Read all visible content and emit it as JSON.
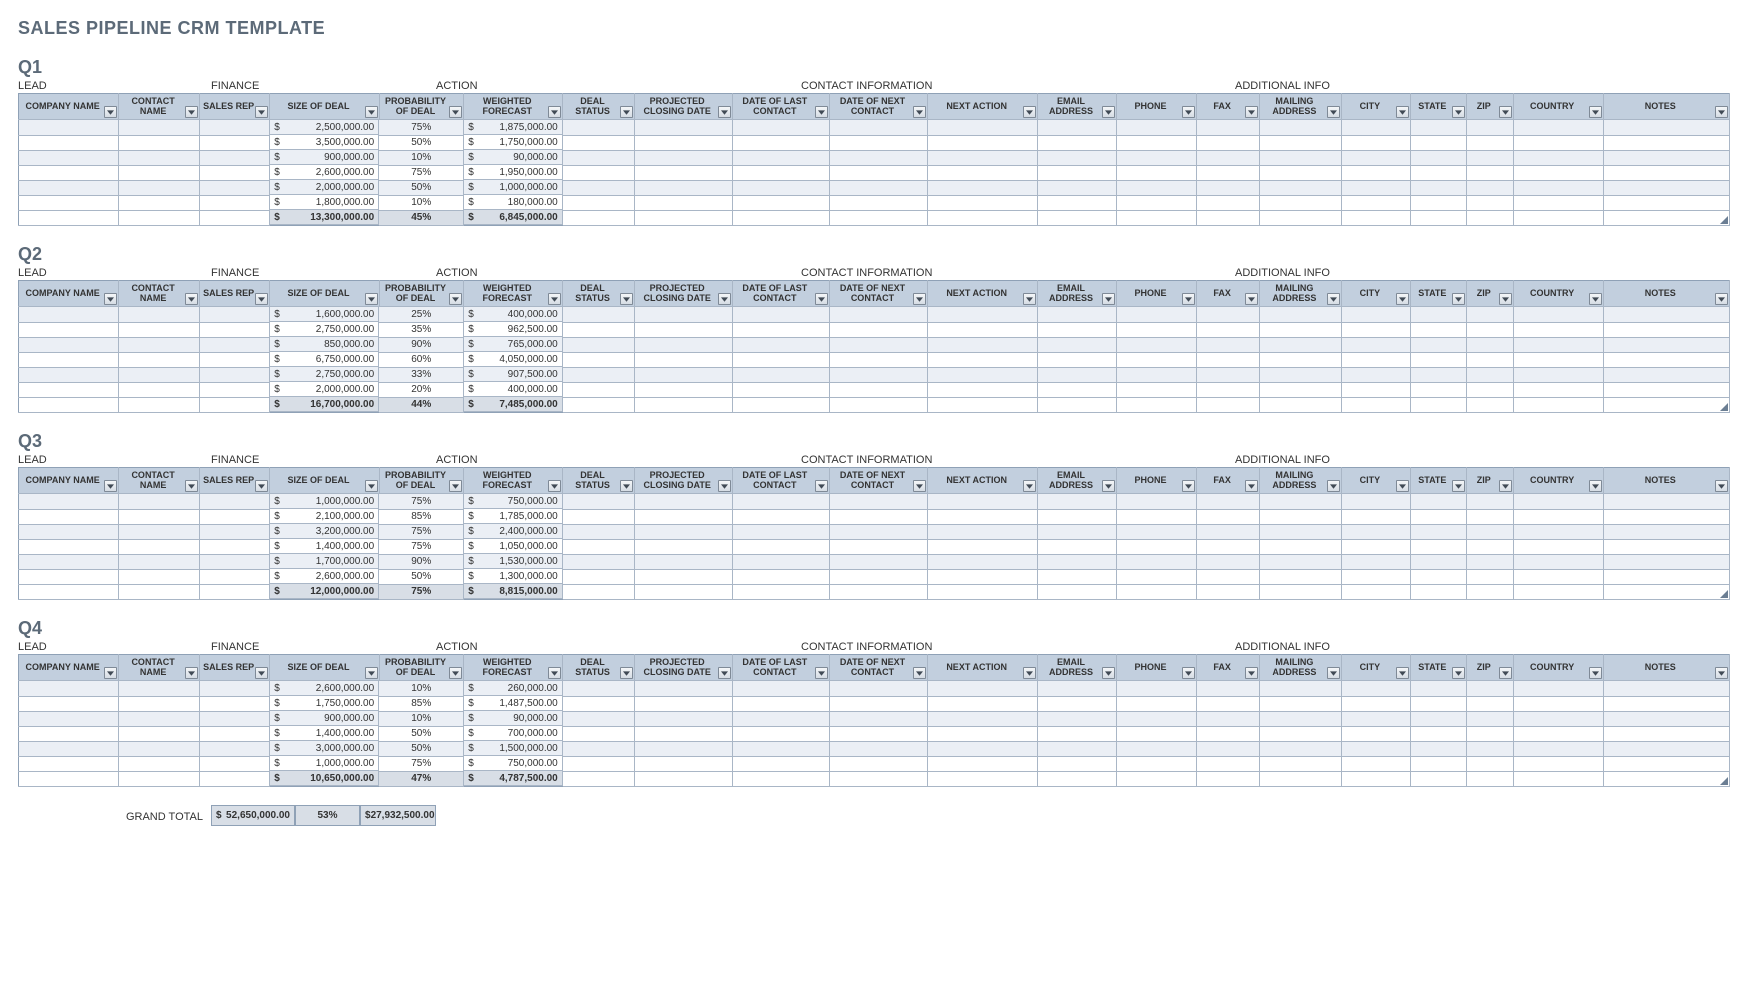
{
  "title": "SALES PIPELINE CRM TEMPLATE",
  "sections": {
    "lead": "LEAD",
    "finance": "FINANCE",
    "action": "ACTION",
    "contact": "CONTACT INFORMATION",
    "additional": "ADDITIONAL INFO"
  },
  "columns": [
    {
      "key": "company",
      "label": "COMPANY NAME",
      "cls": "c-comp"
    },
    {
      "key": "contact",
      "label": "CONTACT NAME",
      "cls": "c-cont"
    },
    {
      "key": "rep",
      "label": "SALES REP",
      "cls": "c-rep"
    },
    {
      "key": "size",
      "label": "SIZE OF DEAL",
      "cls": "c-size",
      "money": true
    },
    {
      "key": "prob",
      "label": "PROBABILITY OF DEAL",
      "cls": "c-prob",
      "pct": true
    },
    {
      "key": "wf",
      "label": "WEIGHTED FORECAST",
      "cls": "c-wf",
      "money": true
    },
    {
      "key": "status",
      "label": "DEAL STATUS",
      "cls": "c-stat"
    },
    {
      "key": "pcd",
      "label": "PROJECTED CLOSING DATE",
      "cls": "c-pcd"
    },
    {
      "key": "dlc",
      "label": "DATE OF LAST CONTACT",
      "cls": "c-dlc"
    },
    {
      "key": "dnc",
      "label": "DATE OF NEXT CONTACT",
      "cls": "c-dnc"
    },
    {
      "key": "na",
      "label": "NEXT ACTION",
      "cls": "c-na"
    },
    {
      "key": "email",
      "label": "EMAIL ADDRESS",
      "cls": "c-email"
    },
    {
      "key": "phone",
      "label": "PHONE",
      "cls": "c-phone"
    },
    {
      "key": "fax",
      "label": "FAX",
      "cls": "c-fax"
    },
    {
      "key": "mail",
      "label": "MAILING ADDRESS",
      "cls": "c-mail"
    },
    {
      "key": "city",
      "label": "CITY",
      "cls": "c-city"
    },
    {
      "key": "state",
      "label": "STATE",
      "cls": "c-state"
    },
    {
      "key": "zip",
      "label": "ZIP",
      "cls": "c-zip"
    },
    {
      "key": "country",
      "label": "COUNTRY",
      "cls": "c-cntry"
    },
    {
      "key": "notes",
      "label": "NOTES",
      "cls": "c-notes"
    }
  ],
  "quarters": [
    {
      "id": "Q1",
      "name": "Q1",
      "rows": [
        {
          "size": "2,500,000.00",
          "prob": "75%",
          "wf": "1,875,000.00"
        },
        {
          "size": "3,500,000.00",
          "prob": "50%",
          "wf": "1,750,000.00"
        },
        {
          "size": "900,000.00",
          "prob": "10%",
          "wf": "90,000.00"
        },
        {
          "size": "2,600,000.00",
          "prob": "75%",
          "wf": "1,950,000.00"
        },
        {
          "size": "2,000,000.00",
          "prob": "50%",
          "wf": "1,000,000.00"
        },
        {
          "size": "1,800,000.00",
          "prob": "10%",
          "wf": "180,000.00"
        }
      ],
      "total": {
        "size": "13,300,000.00",
        "prob": "45%",
        "wf": "6,845,000.00"
      }
    },
    {
      "id": "Q2",
      "name": "Q2",
      "rows": [
        {
          "size": "1,600,000.00",
          "prob": "25%",
          "wf": "400,000.00"
        },
        {
          "size": "2,750,000.00",
          "prob": "35%",
          "wf": "962,500.00"
        },
        {
          "size": "850,000.00",
          "prob": "90%",
          "wf": "765,000.00"
        },
        {
          "size": "6,750,000.00",
          "prob": "60%",
          "wf": "4,050,000.00"
        },
        {
          "size": "2,750,000.00",
          "prob": "33%",
          "wf": "907,500.00"
        },
        {
          "size": "2,000,000.00",
          "prob": "20%",
          "wf": "400,000.00"
        }
      ],
      "total": {
        "size": "16,700,000.00",
        "prob": "44%",
        "wf": "7,485,000.00"
      }
    },
    {
      "id": "Q3",
      "name": "Q3",
      "rows": [
        {
          "size": "1,000,000.00",
          "prob": "75%",
          "wf": "750,000.00"
        },
        {
          "size": "2,100,000.00",
          "prob": "85%",
          "wf": "1,785,000.00"
        },
        {
          "size": "3,200,000.00",
          "prob": "75%",
          "wf": "2,400,000.00"
        },
        {
          "size": "1,400,000.00",
          "prob": "75%",
          "wf": "1,050,000.00"
        },
        {
          "size": "1,700,000.00",
          "prob": "90%",
          "wf": "1,530,000.00"
        },
        {
          "size": "2,600,000.00",
          "prob": "50%",
          "wf": "1,300,000.00"
        }
      ],
      "total": {
        "size": "12,000,000.00",
        "prob": "75%",
        "wf": "8,815,000.00"
      }
    },
    {
      "id": "Q4",
      "name": "Q4",
      "rows": [
        {
          "size": "2,600,000.00",
          "prob": "10%",
          "wf": "260,000.00"
        },
        {
          "size": "1,750,000.00",
          "prob": "85%",
          "wf": "1,487,500.00"
        },
        {
          "size": "900,000.00",
          "prob": "10%",
          "wf": "90,000.00"
        },
        {
          "size": "1,400,000.00",
          "prob": "50%",
          "wf": "700,000.00"
        },
        {
          "size": "3,000,000.00",
          "prob": "50%",
          "wf": "1,500,000.00"
        },
        {
          "size": "1,000,000.00",
          "prob": "75%",
          "wf": "750,000.00"
        }
      ],
      "total": {
        "size": "10,650,000.00",
        "prob": "47%",
        "wf": "4,787,500.00"
      }
    }
  ],
  "grand": {
    "label": "GRAND TOTAL",
    "size": "52,650,000.00",
    "prob": "53%",
    "wf": "27,932,500.00"
  },
  "currency_symbol": "$"
}
